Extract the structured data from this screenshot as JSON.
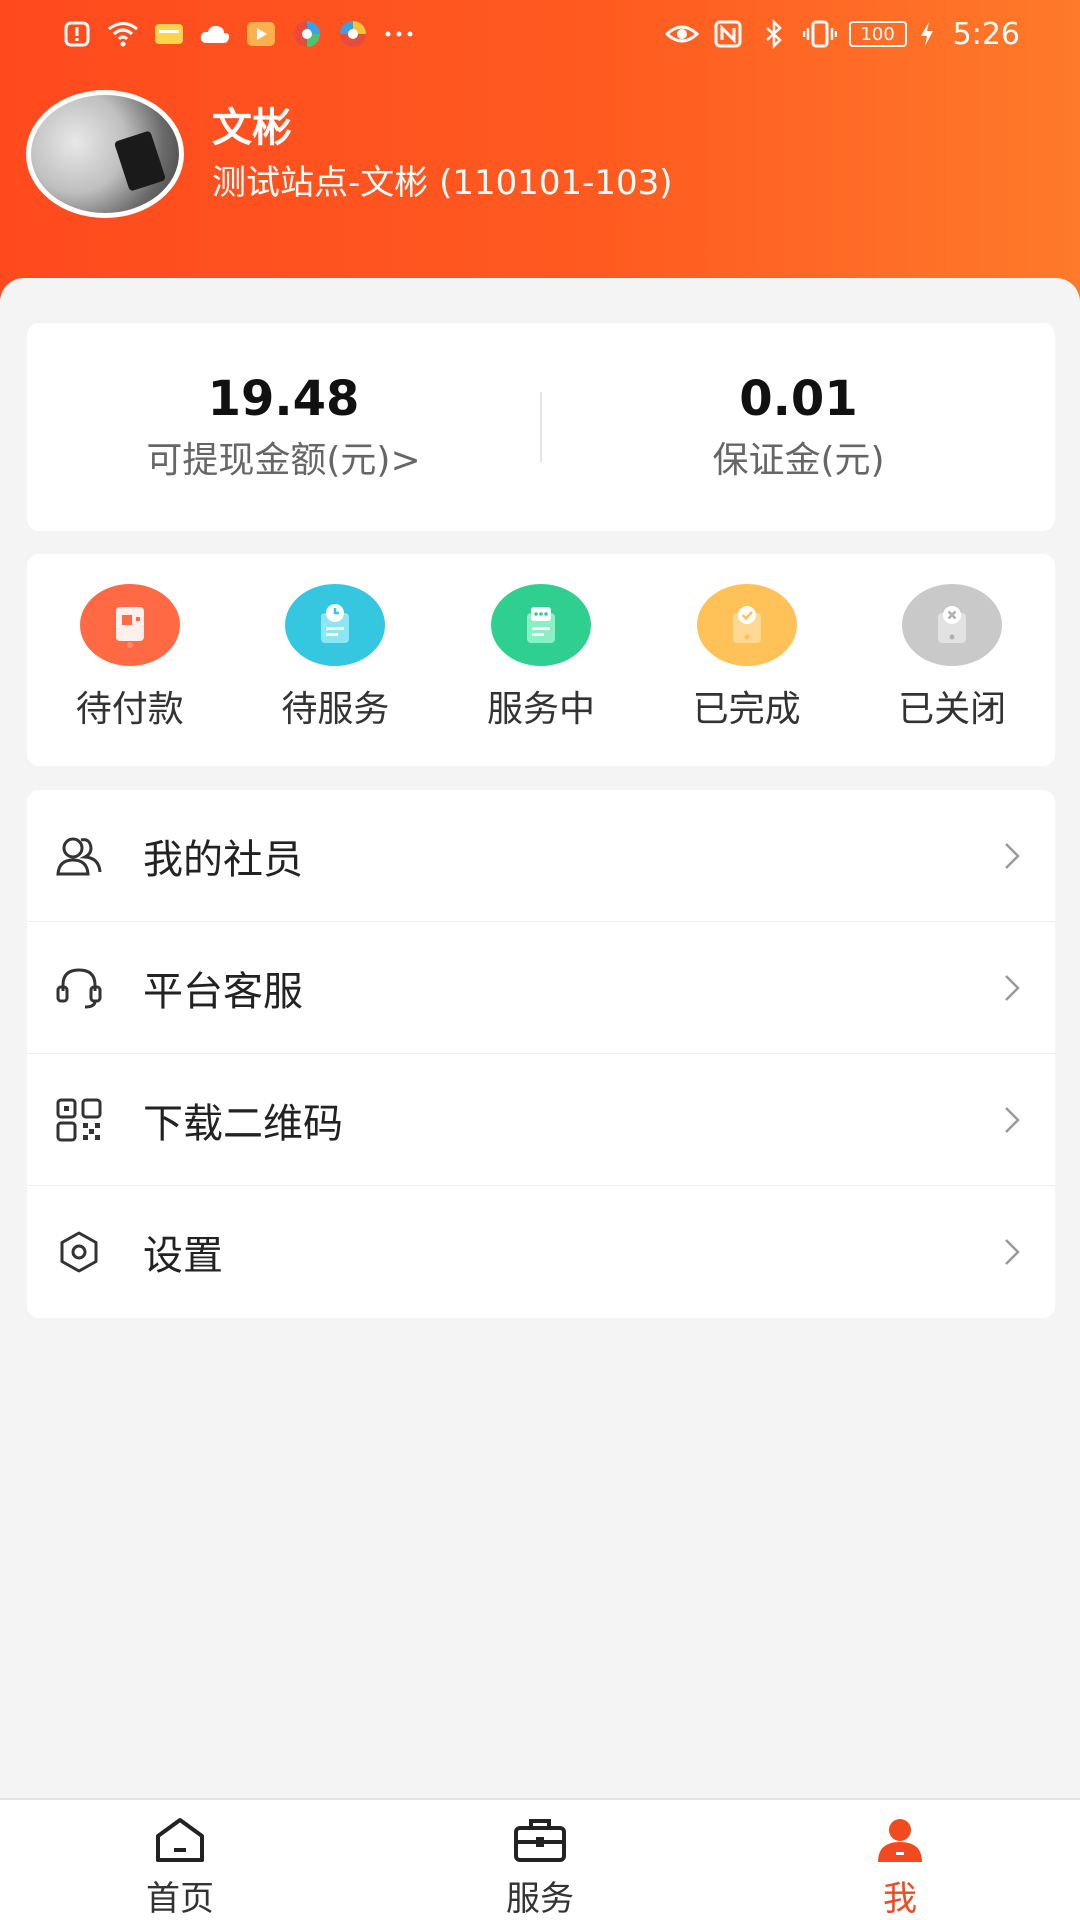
{
  "statusbar": {
    "time": "5:26",
    "battery": "100",
    "left_icons": [
      "alert-icon",
      "wifi-icon",
      "message-icon",
      "cloud-icon",
      "video-icon",
      "app-icon",
      "app-icon-2",
      "more-icon"
    ],
    "right_icons": [
      "eye-icon",
      "nfc-icon",
      "bluetooth-icon",
      "vibrate-icon",
      "battery-icon",
      "charging-icon"
    ]
  },
  "profile": {
    "name": "文彬",
    "site": "测试站点-文彬 (110101-103)"
  },
  "balance": {
    "withdrawable_value": "19.48",
    "withdrawable_label": "可提现金额(元)>",
    "deposit_value": "0.01",
    "deposit_label": "保证金(元)"
  },
  "orders": [
    {
      "label": "待付款",
      "icon": "pending-payment-icon",
      "color": "#ff6a45"
    },
    {
      "label": "待服务",
      "icon": "pending-service-icon",
      "color": "#35c6e0"
    },
    {
      "label": "服务中",
      "icon": "in-service-icon",
      "color": "#2fd08f"
    },
    {
      "label": "已完成",
      "icon": "completed-icon",
      "color": "#ffc259"
    },
    {
      "label": "已关闭",
      "icon": "closed-icon",
      "color": "#c9c9c9"
    }
  ],
  "menu": [
    {
      "label": "我的社员",
      "icon": "members-icon"
    },
    {
      "label": "平台客服",
      "icon": "headset-icon"
    },
    {
      "label": "下载二维码",
      "icon": "qrcode-icon"
    },
    {
      "label": "设置",
      "icon": "settings-icon"
    }
  ],
  "nav": [
    {
      "label": "首页",
      "icon": "home-icon",
      "active": false
    },
    {
      "label": "服务",
      "icon": "briefcase-icon",
      "active": false
    },
    {
      "label": "我",
      "icon": "user-icon",
      "active": true
    }
  ],
  "colors": {
    "accent": "#f04a1e",
    "header_start": "#ff4a1e",
    "header_end": "#ff7a2a"
  }
}
